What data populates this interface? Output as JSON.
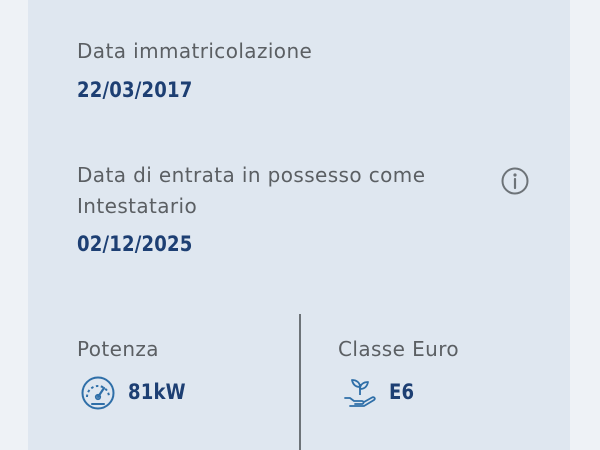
{
  "registration": {
    "label": "Data immatricolazione",
    "value": "22/03/2017"
  },
  "ownership": {
    "label_line1": "Data di entrata in possesso come",
    "label_line2": "Intestatario",
    "value": "02/12/2025",
    "info_icon": "info-icon"
  },
  "power": {
    "label": "Potenza",
    "value": "81kW",
    "icon": "speedometer-icon"
  },
  "euro_class": {
    "label": "Classe Euro",
    "value": "E6",
    "icon": "eco-plant-hand-icon"
  },
  "colors": {
    "card_background": "#dfe7f0",
    "page_background": "#eef2f6",
    "label_text": "#5b5f63",
    "value_text": "#1d3f73",
    "icon_accent": "#2f6fa8"
  }
}
